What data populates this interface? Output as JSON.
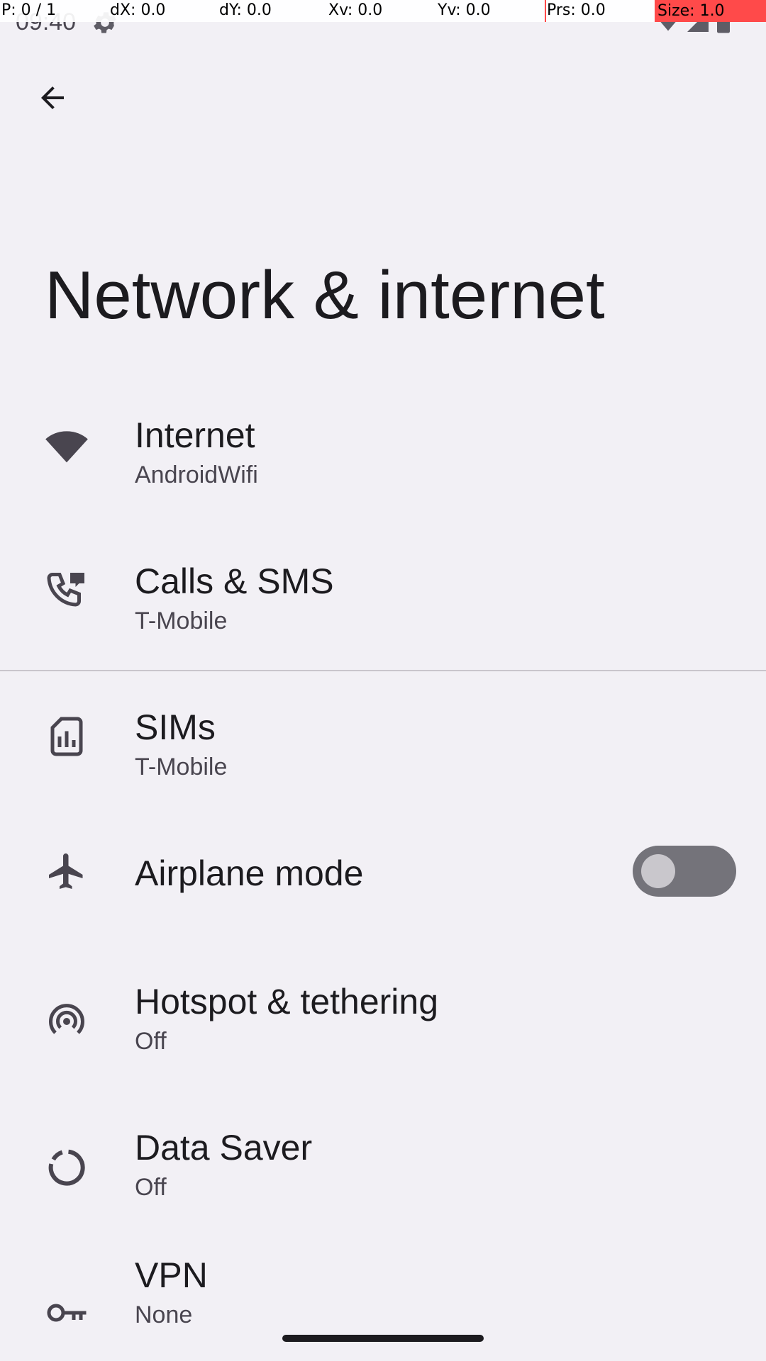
{
  "debug": {
    "p": "P: 0 / 1",
    "dx": "dX: 0.0",
    "dy": "dY: 0.0",
    "xv": "Xv: 0.0",
    "yv": "Yv: 0.0",
    "prs": "Prs: 0.0",
    "size": "Size: 1.0"
  },
  "status": {
    "time": "09:40"
  },
  "header": {
    "title": "Network & internet"
  },
  "items": [
    {
      "title": "Internet",
      "subtitle": "AndroidWifi",
      "icon": "wifi-icon"
    },
    {
      "title": "Calls & SMS",
      "subtitle": "T-Mobile",
      "icon": "phone-icon"
    },
    {
      "title": "SIMs",
      "subtitle": "T-Mobile",
      "icon": "sim-card-icon"
    },
    {
      "title": "Airplane mode",
      "subtitle": "",
      "icon": "airplane-icon",
      "toggle_on": false
    },
    {
      "title": "Hotspot & tethering",
      "subtitle": "Off",
      "icon": "hotspot-icon"
    },
    {
      "title": "Data Saver",
      "subtitle": "Off",
      "icon": "data-saver-icon"
    },
    {
      "title": "VPN",
      "subtitle": "None",
      "icon": "vpn-key-icon"
    }
  ],
  "colors": {
    "background": "#f2f0f5",
    "icon": "#49454f",
    "toggle_track_off": "#74737a"
  }
}
